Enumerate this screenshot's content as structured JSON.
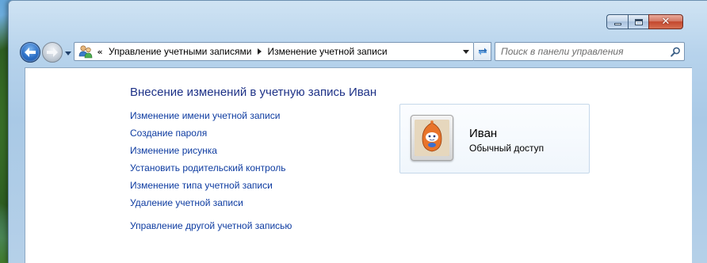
{
  "window": {
    "caption_buttons": {
      "minimize_icon": "minimize-icon",
      "maximize_icon": "maximize-icon",
      "close_icon": "close-icon",
      "close_glyph": "✕"
    }
  },
  "navigation": {
    "back_icon": "arrow-left-icon",
    "forward_icon": "arrow-right-icon",
    "history_icon": "chevron-down-icon"
  },
  "address_bar": {
    "overflow_glyph": "«",
    "breadcrumbs": [
      "Управление учетными записями",
      "Изменение учетной записи"
    ],
    "refresh_icon": "refresh-icon"
  },
  "search": {
    "placeholder": "Поиск в панели управления"
  },
  "page": {
    "title": "Внесение изменений в учетную запись Иван",
    "tasks": [
      "Изменение имени учетной записи",
      "Создание пароля",
      "Изменение рисунка",
      "Установить родительский контроль",
      "Изменение типа учетной записи",
      "Удаление учетной записи"
    ],
    "manage_other": "Управление другой учетной записью"
  },
  "account": {
    "name": "Иван",
    "type": "Обычный доступ"
  },
  "colors": {
    "link": "#0e3ca1",
    "title": "#1e3287",
    "close_button": "#c3472e"
  }
}
